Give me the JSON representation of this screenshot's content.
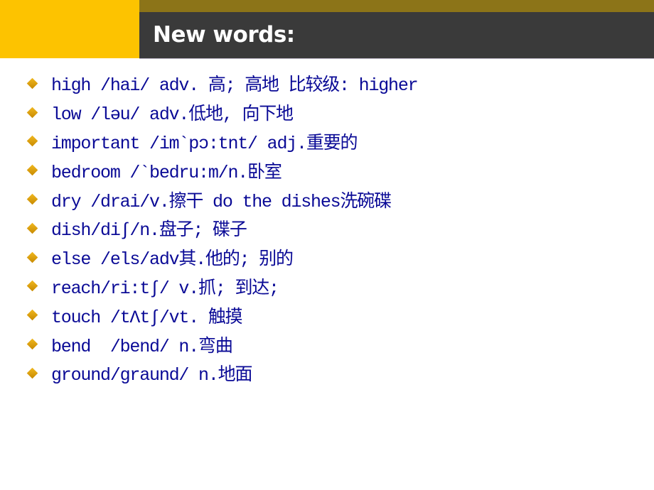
{
  "slide": {
    "title": "New words:",
    "colors": {
      "accent_yellow": "#fdc300",
      "olive_strip": "#8c7418",
      "title_bar": "#3a3a3a",
      "text": "#0a0a96",
      "bullet": "#d9a010"
    },
    "bullet_icon": "diamond-bullet-icon",
    "items": [
      {
        "text": "high /hai/ adv. 高; 高地 比较级: higher"
      },
      {
        "text": "low /ləu/ adv.低地, 向下地"
      },
      {
        "text": "important /im`pɔ:tnt/ adj.重要的"
      },
      {
        "text": "bedroom /`bedru:m/n.卧室"
      },
      {
        "text": "dry /drai/v.擦干 do the dishes洗碗碟"
      },
      {
        "text": "dish/di∫/n.盘子; 碟子"
      },
      {
        "text": "else /els/adv其.他的; 别的"
      },
      {
        "text": "reach/ri:t∫/ v.抓; 到达;"
      },
      {
        "text": "touch /tΛt∫/vt. 触摸"
      },
      {
        "text": "bend  /bend/ n.弯曲"
      },
      {
        "text": "ground/graund/ n.地面"
      }
    ]
  }
}
